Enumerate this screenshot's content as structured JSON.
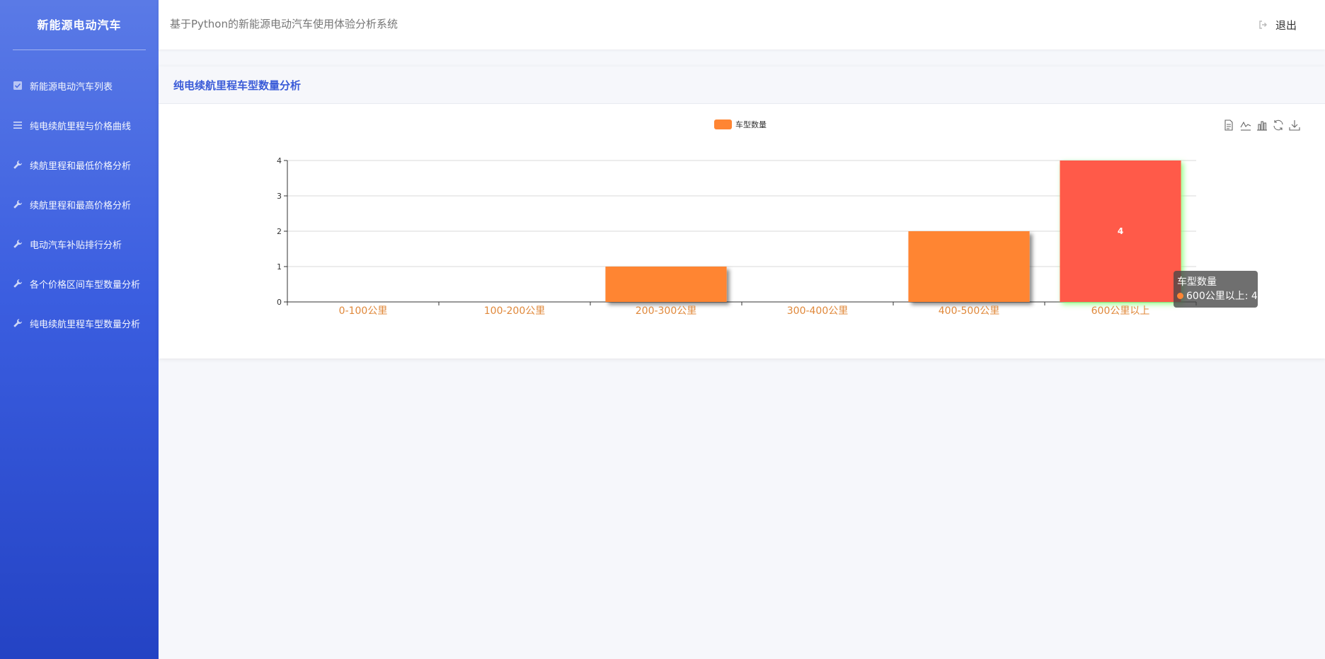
{
  "sidebar": {
    "brand": "新能源电动汽车",
    "items": [
      {
        "label": "新能源电动汽车列表",
        "icon": "checkbox-icon"
      },
      {
        "label": "纯电续航里程与价格曲线",
        "icon": "list-icon"
      },
      {
        "label": "续航里程和最低价格分析",
        "icon": "wrench-icon"
      },
      {
        "label": "续航里程和最高价格分析",
        "icon": "wrench-icon"
      },
      {
        "label": "电动汽车补贴排行分析",
        "icon": "wrench-icon"
      },
      {
        "label": "各个价格区间车型数量分析",
        "icon": "wrench-icon"
      },
      {
        "label": "纯电续航里程车型数量分析",
        "icon": "wrench-icon"
      }
    ]
  },
  "header": {
    "title": "基于Python的新能源电动汽车使用体验分析系统",
    "logout_label": "退出"
  },
  "panel": {
    "title": "纯电续航里程车型数量分析"
  },
  "toolbox": [
    "data-view-icon",
    "line-switch-icon",
    "bar-switch-icon",
    "restore-icon",
    "save-image-icon"
  ],
  "chart_data": {
    "type": "bar",
    "categories": [
      "0-100公里",
      "100-200公里",
      "200-300公里",
      "300-400公里",
      "400-500公里",
      "600公里以上"
    ],
    "series": [
      {
        "name": "车型数量",
        "values": [
          0,
          0,
          1,
          0,
          2,
          4
        ]
      }
    ],
    "ylim": [
      0,
      4
    ],
    "yticks": [
      0,
      1,
      2,
      3,
      4
    ],
    "grid": true,
    "legend": "top-center",
    "bar_color": "#ff8533",
    "highlight_color": "#ff5a4a",
    "highlight_index": 5,
    "data_label": "4",
    "axis_label_color": "#e0883a"
  },
  "tooltip": {
    "title": "车型数量",
    "line": "600公里以上: 4"
  }
}
